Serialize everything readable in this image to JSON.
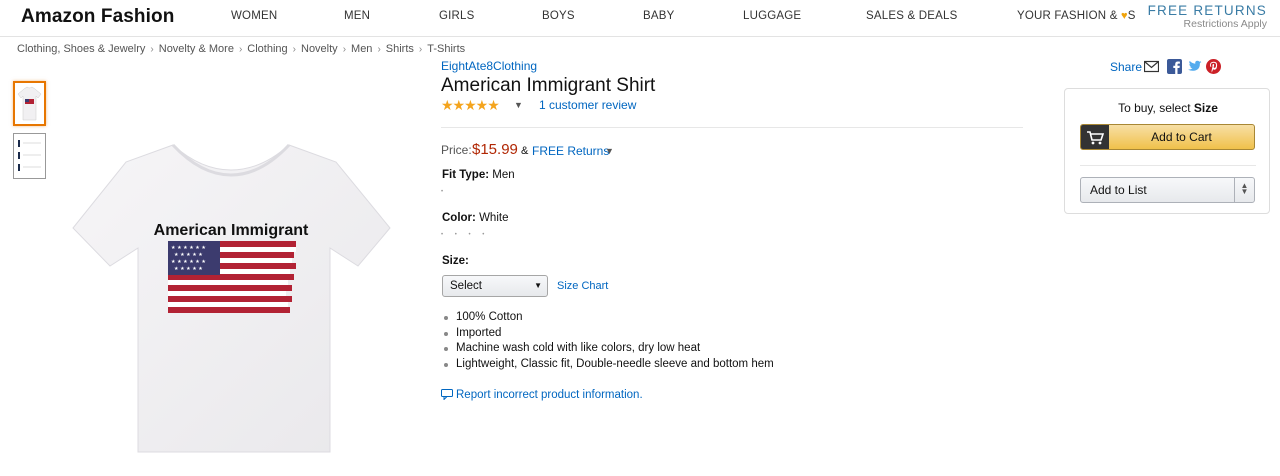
{
  "nav": {
    "logo": "Amazon Fashion",
    "items": [
      "WOMEN",
      "MEN",
      "GIRLS",
      "BOYS",
      "BABY",
      "LUGGAGE",
      "SALES & DEALS"
    ],
    "your_fashion_prefix": "YOUR FASHION &",
    "your_fashion_suffix": "S",
    "free_returns": "FREE RETURNS",
    "restrictions": "Restrictions Apply"
  },
  "breadcrumb": [
    "Clothing, Shoes & Jewelry",
    "Novelty & More",
    "Clothing",
    "Novelty",
    "Men",
    "Shirts",
    "T-Shirts"
  ],
  "breadcrumb_sep": "›",
  "product": {
    "brand": "EightAte8Clothing",
    "title": "American Immigrant Shirt",
    "stars": "★★★★★",
    "rating": 5,
    "reviews": "1 customer review",
    "price_label": "Price:",
    "price": "$15.99",
    "amp": "&",
    "free_returns": "FREE Returns",
    "fit_label": "Fit Type:",
    "fit_value": "Men",
    "color_label": "Color:",
    "color_value": "White",
    "size_label": "Size:",
    "size_select": "Select",
    "size_chart": "Size Chart",
    "shirt_text": "American Immigrant",
    "bullets": [
      "100% Cotton",
      "Imported",
      "Machine wash cold with like colors, dry low heat",
      "Lightweight, Classic fit, Double-needle sleeve and bottom hem"
    ],
    "report": "Report incorrect product information."
  },
  "share": {
    "label": "Share"
  },
  "buybox": {
    "to_buy_prefix": "To buy, select",
    "to_buy_bold": "Size",
    "add_to_cart": "Add to Cart",
    "add_to_list": "Add to List"
  },
  "colors": {
    "accent_link": "#0066c0",
    "price": "#b12704",
    "star": "#f4a41d",
    "cart_button": "#f0c14b",
    "free_returns": "#3a7ca5"
  }
}
